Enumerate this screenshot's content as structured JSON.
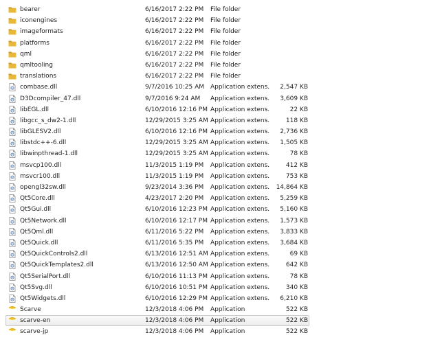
{
  "files": [
    {
      "name": "bearer",
      "date": "6/16/2017 2:22 PM",
      "type": "File folder",
      "size": "",
      "icon": "folder-icon"
    },
    {
      "name": "iconengines",
      "date": "6/16/2017 2:22 PM",
      "type": "File folder",
      "size": "",
      "icon": "folder-icon"
    },
    {
      "name": "imageformats",
      "date": "6/16/2017 2:22 PM",
      "type": "File folder",
      "size": "",
      "icon": "folder-icon"
    },
    {
      "name": "platforms",
      "date": "6/16/2017 2:22 PM",
      "type": "File folder",
      "size": "",
      "icon": "folder-icon"
    },
    {
      "name": "qml",
      "date": "6/16/2017 2:22 PM",
      "type": "File folder",
      "size": "",
      "icon": "folder-icon"
    },
    {
      "name": "qmltooling",
      "date": "6/16/2017 2:22 PM",
      "type": "File folder",
      "size": "",
      "icon": "folder-icon"
    },
    {
      "name": "translations",
      "date": "6/16/2017 2:22 PM",
      "type": "File folder",
      "size": "",
      "icon": "folder-icon"
    },
    {
      "name": "combase.dll",
      "date": "9/7/2016 10:25 AM",
      "type": "Application extens...",
      "size": "2,547 KB",
      "icon": "dll-file-icon"
    },
    {
      "name": "D3Dcompiler_47.dll",
      "date": "9/7/2016 9:24 AM",
      "type": "Application extens...",
      "size": "3,609 KB",
      "icon": "dll-file-icon"
    },
    {
      "name": "libEGL.dll",
      "date": "6/10/2016 12:16 PM",
      "type": "Application extens...",
      "size": "22 KB",
      "icon": "dll-file-icon"
    },
    {
      "name": "libgcc_s_dw2-1.dll",
      "date": "12/29/2015 3:25 AM",
      "type": "Application extens...",
      "size": "118 KB",
      "icon": "dll-file-icon"
    },
    {
      "name": "libGLESV2.dll",
      "date": "6/10/2016 12:16 PM",
      "type": "Application extens...",
      "size": "2,736 KB",
      "icon": "dll-file-icon"
    },
    {
      "name": "libstdc++-6.dll",
      "date": "12/29/2015 3:25 AM",
      "type": "Application extens...",
      "size": "1,505 KB",
      "icon": "dll-file-icon"
    },
    {
      "name": "libwinpthread-1.dll",
      "date": "12/29/2015 3:25 AM",
      "type": "Application extens...",
      "size": "78 KB",
      "icon": "dll-file-icon"
    },
    {
      "name": "msvcp100.dll",
      "date": "11/3/2015 1:19 PM",
      "type": "Application extens...",
      "size": "412 KB",
      "icon": "dll-file-icon"
    },
    {
      "name": "msvcr100.dll",
      "date": "11/3/2015 1:19 PM",
      "type": "Application extens...",
      "size": "753 KB",
      "icon": "dll-file-icon"
    },
    {
      "name": "opengl32sw.dll",
      "date": "9/23/2014 3:36 PM",
      "type": "Application extens...",
      "size": "14,864 KB",
      "icon": "dll-file-icon"
    },
    {
      "name": "Qt5Core.dll",
      "date": "4/23/2017 2:20 PM",
      "type": "Application extens...",
      "size": "5,259 KB",
      "icon": "dll-file-icon"
    },
    {
      "name": "Qt5Gui.dll",
      "date": "6/10/2016 12:23 PM",
      "type": "Application extens...",
      "size": "5,160 KB",
      "icon": "dll-file-icon"
    },
    {
      "name": "Qt5Network.dll",
      "date": "6/10/2016 12:17 PM",
      "type": "Application extens...",
      "size": "1,573 KB",
      "icon": "dll-file-icon"
    },
    {
      "name": "Qt5Qml.dll",
      "date": "6/11/2016 5:22 PM",
      "type": "Application extens...",
      "size": "3,833 KB",
      "icon": "dll-file-icon"
    },
    {
      "name": "Qt5Quick.dll",
      "date": "6/11/2016 5:35 PM",
      "type": "Application extens...",
      "size": "3,684 KB",
      "icon": "dll-file-icon"
    },
    {
      "name": "Qt5QuickControls2.dll",
      "date": "6/13/2016 12:51 AM",
      "type": "Application extens...",
      "size": "69 KB",
      "icon": "dll-file-icon"
    },
    {
      "name": "Qt5QuickTemplates2.dll",
      "date": "6/13/2016 12:50 AM",
      "type": "Application extens...",
      "size": "642 KB",
      "icon": "dll-file-icon"
    },
    {
      "name": "Qt5SerialPort.dll",
      "date": "6/10/2016 11:13 PM",
      "type": "Application extens...",
      "size": "78 KB",
      "icon": "dll-file-icon"
    },
    {
      "name": "Qt5Svg.dll",
      "date": "6/10/2016 10:51 PM",
      "type": "Application extens...",
      "size": "340 KB",
      "icon": "dll-file-icon"
    },
    {
      "name": "Qt5Widgets.dll",
      "date": "6/10/2016 12:29 PM",
      "type": "Application extens...",
      "size": "6,210 KB",
      "icon": "dll-file-icon"
    },
    {
      "name": "Scarve",
      "date": "12/3/2018 4:06 PM",
      "type": "Application",
      "size": "522 KB",
      "icon": "app-icon"
    },
    {
      "name": "scarve-en",
      "date": "12/3/2018 4:06 PM",
      "type": "Application",
      "size": "522 KB",
      "icon": "app-icon",
      "selected": true
    },
    {
      "name": "scarve-jp",
      "date": "12/3/2018 4:06 PM",
      "type": "Application",
      "size": "522 KB",
      "icon": "app-icon"
    }
  ],
  "colors": {
    "folder": "#e8b838",
    "folder_dark": "#c9962a",
    "dll_blue": "#6f8fbf",
    "app_yellow": "#f2c417",
    "selection_border": "#c9c9c9"
  }
}
